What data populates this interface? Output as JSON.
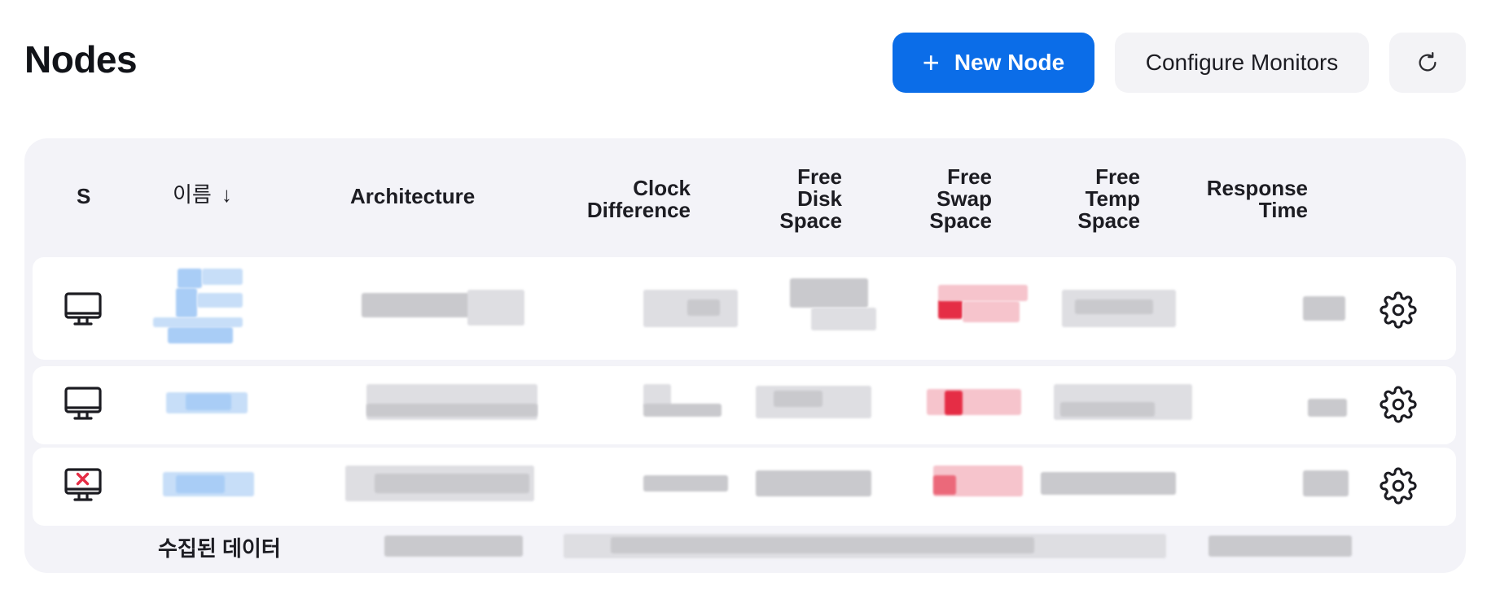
{
  "page": {
    "title": "Nodes"
  },
  "toolbar": {
    "new_node_label": "New Node",
    "configure_monitors_label": "Configure Monitors"
  },
  "table": {
    "columns": {
      "status": "S",
      "name": "이름",
      "sort_indicator": "↓",
      "architecture": "Architecture",
      "clock_difference": [
        "Clock",
        "Difference"
      ],
      "free_disk_space": [
        "Free",
        "Disk",
        "Space"
      ],
      "free_swap_space": [
        "Free",
        "Swap",
        "Space"
      ],
      "free_temp_space": [
        "Free",
        "Temp",
        "Space"
      ],
      "response_time": [
        "Response",
        "Time"
      ]
    },
    "rows": [
      {
        "status_icon": "monitor-icon"
      },
      {
        "status_icon": "monitor-icon"
      },
      {
        "status_icon": "monitor-offline-icon"
      }
    ],
    "footer_label": "수집된 데이터"
  },
  "colors": {
    "primary": "#0b6de8",
    "panel_bg": "#f3f3f8",
    "offline_red": "#e52d45"
  }
}
